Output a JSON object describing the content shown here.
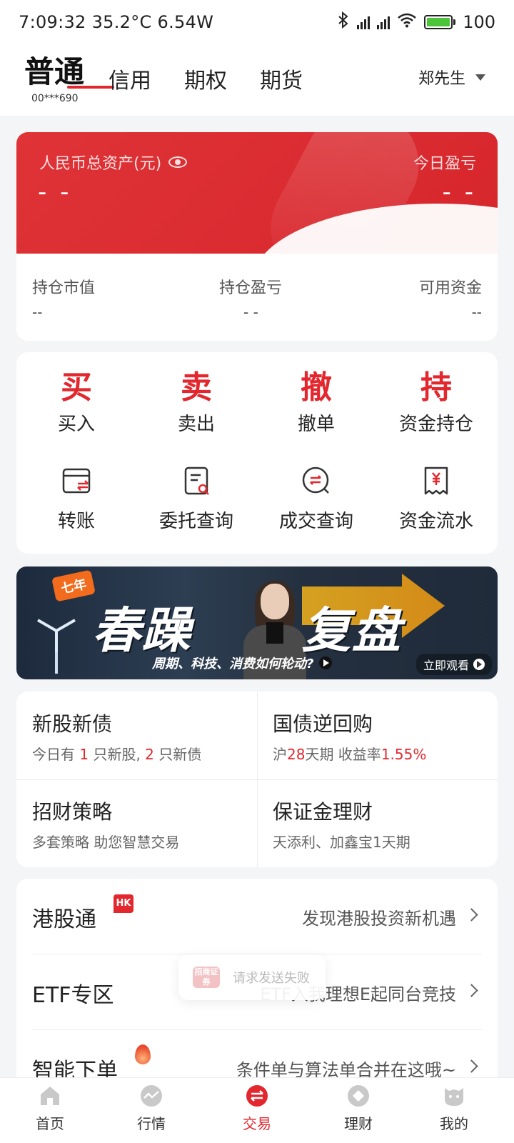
{
  "status": {
    "time": "7:09:32",
    "temp": "35.2°C",
    "power": "6.54W",
    "battery": "100"
  },
  "header": {
    "main_tab": "普通",
    "account_no": "00***690",
    "tabs": [
      "信用",
      "期权",
      "期货"
    ],
    "user": "郑先生"
  },
  "assets": {
    "total_label": "人民币总资产(元)",
    "total_value": "- -",
    "pl_label": "今日盈亏",
    "pl_value": "- -",
    "holding_value_label": "持仓市值",
    "holding_value": "--",
    "holding_pl_label": "持仓盈亏",
    "holding_pl": "- -",
    "available_label": "可用资金",
    "available": "--"
  },
  "actions": {
    "row1": [
      {
        "glyph": "买",
        "label": "买入"
      },
      {
        "glyph": "卖",
        "label": "卖出"
      },
      {
        "glyph": "撤",
        "label": "撤单"
      },
      {
        "glyph": "持",
        "label": "资金持仓"
      }
    ],
    "row2": [
      {
        "icon": "transfer-icon",
        "label": "转账"
      },
      {
        "icon": "order-query-icon",
        "label": "委托查询"
      },
      {
        "icon": "deal-query-icon",
        "label": "成交查询"
      },
      {
        "icon": "fund-flow-icon",
        "label": "资金流水"
      }
    ]
  },
  "banner": {
    "badge": "七年",
    "title1": "春躁",
    "title2": "复盘",
    "subtitle": "周期、科技、消费如何轮动?",
    "watch": "立即观看"
  },
  "grid": [
    {
      "title": "新股新债",
      "sub_a": "今日有 ",
      "n1": "1",
      "sub_b": " 只新股, ",
      "n2": "2",
      "sub_c": " 只新债"
    },
    {
      "title": "国债逆回购",
      "sub_a": "沪",
      "n1": "28",
      "sub_b": "天期 收益率",
      "n2": "1.55%",
      "sub_c": ""
    },
    {
      "title": "招财策略",
      "sub": "多套策略 助您智慧交易"
    },
    {
      "title": "保证金理财",
      "sub": "天添利、加鑫宝1天期"
    }
  ],
  "list": [
    {
      "title": "港股通",
      "badge": "HK",
      "desc": "发现港股投资新机遇"
    },
    {
      "title": "ETF专区",
      "desc": "ETF入我理想E起同台竞技"
    },
    {
      "title": "智能下单",
      "desc": "条件单与算法单合并在这哦~"
    }
  ],
  "toast": {
    "logo": "招商证券",
    "text": "请求发送失败"
  },
  "nav": [
    {
      "label": "首页",
      "icon": "home-icon"
    },
    {
      "label": "行情",
      "icon": "market-icon"
    },
    {
      "label": "交易",
      "icon": "trade-icon"
    },
    {
      "label": "理财",
      "icon": "wealth-icon"
    },
    {
      "label": "我的",
      "icon": "profile-icon"
    }
  ],
  "colors": {
    "accent": "#e2282e"
  }
}
